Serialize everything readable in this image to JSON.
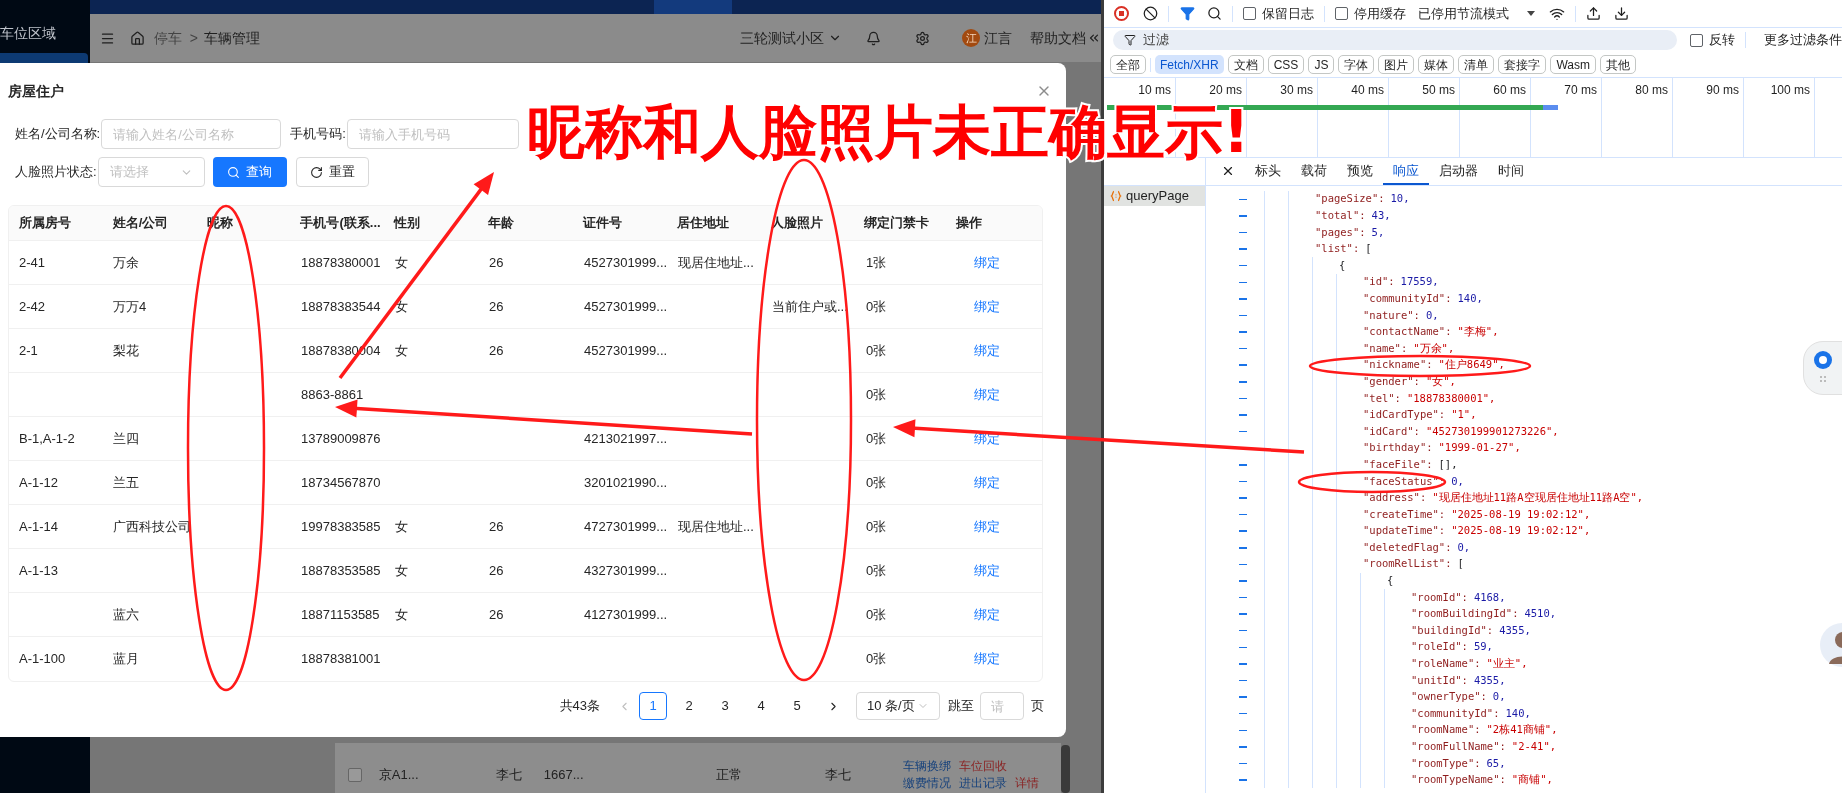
{
  "app": {
    "sidebar": {
      "title": "车位区域"
    },
    "breadcrumb": {
      "items": [
        "停车",
        "车辆管理"
      ],
      "separator": ">"
    },
    "community": "三轮测试小区",
    "user": {
      "avatar": "江",
      "name": "江言"
    },
    "help": "帮助文档",
    "background_row": {
      "checked": false,
      "cells": [
        "京A1...",
        "李七",
        "1667...",
        "正常",
        "李七"
      ],
      "actions": [
        {
          "label": "车辆换绑",
          "kind": "link"
        },
        {
          "label": "车位回收",
          "kind": "danger"
        },
        {
          "label": "缴费情况",
          "kind": "link"
        },
        {
          "label": "进出记录",
          "kind": "link"
        },
        {
          "label": "详情",
          "kind": "danger"
        }
      ]
    }
  },
  "modal": {
    "title": "房屋住户",
    "form": {
      "rows": [
        {
          "items": [
            {
              "kind": "input",
              "label": "姓名/公司名称:",
              "placeholder": "请输入姓名/公司名称"
            },
            {
              "kind": "input",
              "label": "手机号码:",
              "placeholder": "请输入手机号码"
            }
          ]
        },
        {
          "items": [
            {
              "kind": "select",
              "label": "人脸照片状态:",
              "placeholder": "请选择"
            },
            {
              "kind": "primary_button",
              "label": "查询"
            },
            {
              "kind": "button",
              "label": "重置"
            }
          ]
        }
      ]
    },
    "table": {
      "columns": [
        {
          "label": "所属房号",
          "kind": "text"
        },
        {
          "label": "姓名/公司",
          "kind": "text"
        },
        {
          "label": "昵称",
          "kind": "text"
        },
        {
          "label": "手机号(联系...",
          "kind": "text"
        },
        {
          "label": "性别",
          "kind": "text"
        },
        {
          "label": "年龄",
          "kind": "text"
        },
        {
          "label": "证件号",
          "kind": "text"
        },
        {
          "label": "居住地址",
          "kind": "text"
        },
        {
          "label": "人脸照片",
          "kind": "text"
        },
        {
          "label": "绑定门禁卡",
          "kind": "text"
        },
        {
          "label": "操作",
          "kind": "action"
        }
      ],
      "rows": [
        {
          "cells": [
            "2-41",
            "万余",
            null,
            "18878380001",
            "女",
            "26",
            "4527301999...",
            "现居住地址...",
            null,
            "1张",
            "绑定"
          ]
        },
        {
          "cells": [
            "2-42",
            "万万4",
            null,
            "18878383544",
            "女",
            "26",
            "4527301999...",
            null,
            "当前住户或...",
            "0张",
            "绑定"
          ]
        },
        {
          "cells": [
            "2-1",
            "梨花",
            null,
            "18878380004",
            "女",
            "26",
            "4527301999...",
            null,
            null,
            "0张",
            "绑定"
          ]
        },
        {
          "cells": [
            null,
            null,
            null,
            "8863-8861",
            null,
            null,
            null,
            null,
            null,
            "0张",
            "绑定"
          ]
        },
        {
          "cells": [
            "B-1,A-1-2",
            "兰四",
            null,
            "13789009876",
            null,
            null,
            "4213021997...",
            null,
            null,
            "0张",
            "绑定"
          ]
        },
        {
          "cells": [
            "A-1-12",
            "兰五",
            null,
            "18734567870",
            null,
            null,
            "3201021990...",
            null,
            null,
            "0张",
            "绑定"
          ]
        },
        {
          "cells": [
            "A-1-14",
            "广西科技公司",
            null,
            "19978383585",
            "女",
            "26",
            "4727301999...",
            "现居住地址...",
            null,
            "0张",
            "绑定"
          ]
        },
        {
          "cells": [
            "A-1-13",
            null,
            null,
            "18878353585",
            "女",
            "26",
            "4327301999...",
            null,
            null,
            "0张",
            "绑定"
          ]
        },
        {
          "cells": [
            null,
            "蓝六",
            null,
            "18871153585",
            "女",
            "26",
            "4127301999...",
            null,
            null,
            "0张",
            "绑定"
          ]
        },
        {
          "cells": [
            "A-1-100",
            "蓝月",
            null,
            "18878381001",
            null,
            null,
            null,
            null,
            null,
            "0张",
            "绑定"
          ]
        }
      ]
    },
    "pagination": {
      "total": "共43条",
      "pages": [
        {
          "label": "1",
          "selected": true
        },
        {
          "label": "2",
          "selected": false
        },
        {
          "label": "3",
          "selected": false
        },
        {
          "label": "4",
          "selected": false
        },
        {
          "label": "5",
          "selected": false
        }
      ],
      "page_size": "10 条/页",
      "jump_label": "跳至",
      "jump_placeholder": "请",
      "page_suffix": "页"
    }
  },
  "annotation": {
    "headline": "昵称和人脸照片未正确显示!"
  },
  "devtools": {
    "toolbar": {
      "preserve_log": {
        "label": "保留日志",
        "checked": false
      },
      "disable_cache": {
        "label": "停用缓存",
        "checked": false
      },
      "throttling": "已停用节流模式"
    },
    "filter": {
      "placeholder": "过滤",
      "invert": {
        "label": "反转",
        "checked": false
      },
      "more": "更多过滤条件"
    },
    "type_filters": [
      {
        "label": "全部",
        "selected": false
      },
      {
        "label": "Fetch/XHR",
        "selected": true
      },
      {
        "label": "文档",
        "selected": false
      },
      {
        "label": "CSS",
        "selected": false
      },
      {
        "label": "JS",
        "selected": false
      },
      {
        "label": "字体",
        "selected": false
      },
      {
        "label": "图片",
        "selected": false
      },
      {
        "label": "媒体",
        "selected": false
      },
      {
        "label": "清单",
        "selected": false
      },
      {
        "label": "套接字",
        "selected": false
      },
      {
        "label": "Wasm",
        "selected": false
      },
      {
        "label": "其他",
        "selected": false
      }
    ],
    "timeline": {
      "ticks": [
        "10 ms",
        "20 ms",
        "30 ms",
        "40 ms",
        "50 ms",
        "60 ms",
        "70 ms",
        "80 ms",
        "90 ms",
        "100 ms"
      ]
    },
    "tabs": [
      {
        "label": "标头",
        "selected": false
      },
      {
        "label": "载荷",
        "selected": false
      },
      {
        "label": "预览",
        "selected": false
      },
      {
        "label": "响应",
        "selected": true
      },
      {
        "label": "启动器",
        "selected": false
      },
      {
        "label": "时间",
        "selected": false
      }
    ],
    "requests": [
      {
        "name": "queryPage",
        "selected": true
      }
    ],
    "response": [
      {
        "key": "\"pageSize\":",
        "value": "10,",
        "kind": "number"
      },
      {
        "key": "\"total\":",
        "value": "43,",
        "kind": "number"
      },
      {
        "key": "\"pages\":",
        "value": "5,",
        "kind": "number"
      },
      {
        "key": "\"list\":",
        "value": "[",
        "kind": "bracket",
        "children": [
          {
            "value": "{",
            "kind": "bracket",
            "children": [
              {
                "key": "\"id\":",
                "value": "17559,",
                "kind": "number"
              },
              {
                "key": "\"communityId\":",
                "value": "140,",
                "kind": "number"
              },
              {
                "key": "\"nature\":",
                "value": "0,",
                "kind": "number"
              },
              {
                "key": "\"contactName\":",
                "value": "\"李梅\",",
                "kind": "string"
              },
              {
                "key": "\"name\":",
                "value": "\"万余\",",
                "kind": "string"
              },
              {
                "key": "\"nickname\":",
                "value": "\"住户8649\",",
                "kind": "string"
              },
              {
                "key": "\"gender\":",
                "value": "\"女\",",
                "kind": "string"
              },
              {
                "key": "\"tel\":",
                "value": "\"18878380001\",",
                "kind": "string"
              },
              {
                "key": "\"idCardType\":",
                "value": "\"1\",",
                "kind": "string"
              },
              {
                "key": "\"idCard\":",
                "value": "\"452730199901273226\",",
                "kind": "string"
              },
              {
                "key": "\"birthday\":",
                "value": "\"1999-01-27\",",
                "kind": "string"
              },
              {
                "key": "\"faceFile\":",
                "value": "[],",
                "kind": "bracket"
              },
              {
                "key": "\"faceStatus\":",
                "value": "0,",
                "kind": "number"
              },
              {
                "key": "\"address\":",
                "value": "\"现居住地址11路A空现居住地址11路A空\",",
                "kind": "string"
              },
              {
                "key": "\"createTime\":",
                "value": "\"2025-08-19 19:02:12\",",
                "kind": "string"
              },
              {
                "key": "\"updateTime\":",
                "value": "\"2025-08-19 19:02:12\",",
                "kind": "string"
              },
              {
                "key": "\"deletedFlag\":",
                "value": "0,",
                "kind": "number"
              },
              {
                "key": "\"roomRelList\":",
                "value": "[",
                "kind": "bracket",
                "children": [
                  {
                    "value": "{",
                    "kind": "bracket",
                    "children": [
                      {
                        "key": "\"roomId\":",
                        "value": "4168,",
                        "kind": "number"
                      },
                      {
                        "key": "\"roomBuildingId\":",
                        "value": "4510,",
                        "kind": "number"
                      },
                      {
                        "key": "\"buildingId\":",
                        "value": "4355,",
                        "kind": "number"
                      },
                      {
                        "key": "\"roleId\":",
                        "value": "59,",
                        "kind": "number"
                      },
                      {
                        "key": "\"roleName\":",
                        "value": "\"业主\",",
                        "kind": "string"
                      },
                      {
                        "key": "\"unitId\":",
                        "value": "4355,",
                        "kind": "number"
                      },
                      {
                        "key": "\"ownerType\":",
                        "value": "0,",
                        "kind": "number"
                      },
                      {
                        "key": "\"communityId\":",
                        "value": "140,",
                        "kind": "number"
                      },
                      {
                        "key": "\"roomName\":",
                        "value": "\"2栋41商铺\",",
                        "kind": "string"
                      },
                      {
                        "key": "\"roomFullName\":",
                        "value": "\"2-41\",",
                        "kind": "string"
                      },
                      {
                        "key": "\"roomType\":",
                        "value": "65,",
                        "kind": "number"
                      },
                      {
                        "key": "\"roomTypeName\":",
                        "value": "\"商铺\",",
                        "kind": "string"
                      }
                    ]
                  }
                ]
              }
            ]
          }
        ]
      }
    ]
  }
}
